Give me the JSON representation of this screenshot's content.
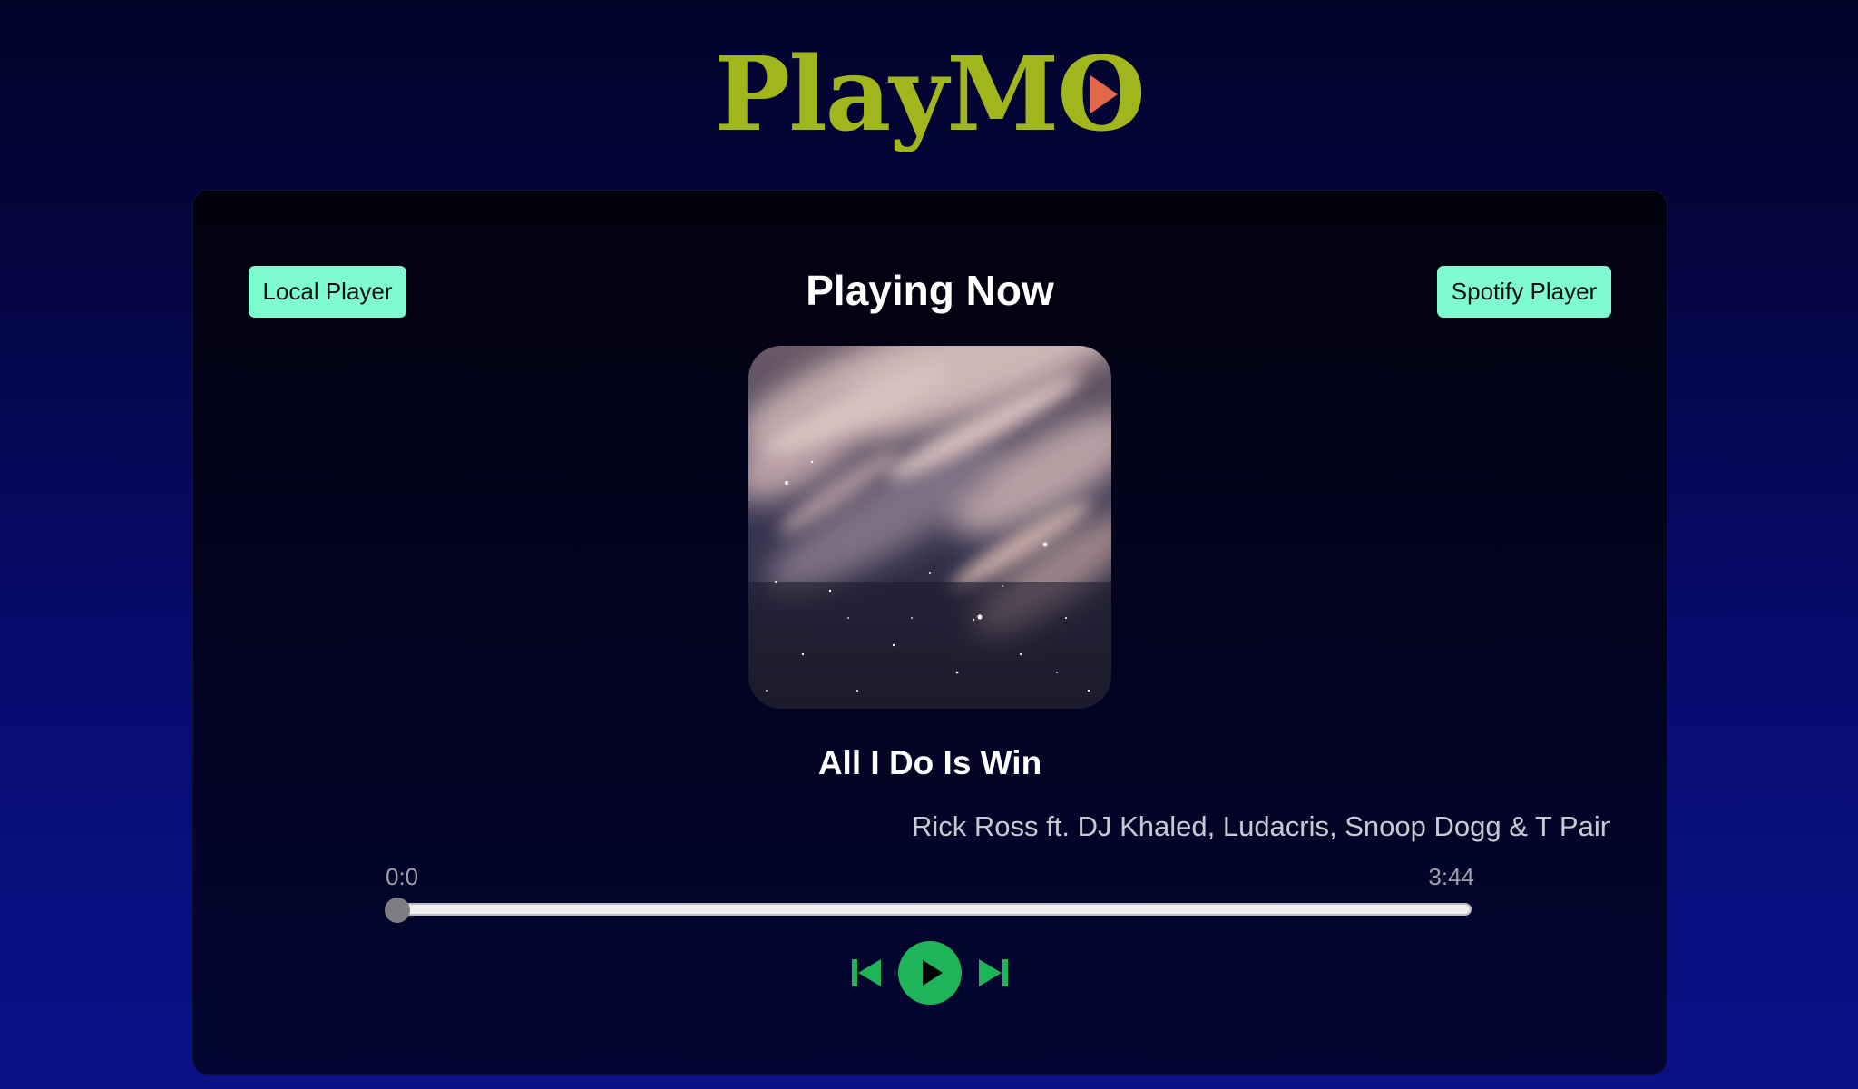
{
  "app": {
    "logo_text_1": "PlayM",
    "logo_text_2": "O",
    "logo_color": "#a1b51d",
    "logo_accent_color": "#e4674a"
  },
  "player": {
    "heading": "Playing Now",
    "local_button_label": "Local Player",
    "spotify_button_label": "Spotify Player",
    "button_color": "#7ffbd0",
    "track": {
      "title": "All I Do Is Win",
      "artist": "Rick Ross ft. DJ Khaled, Ludacris, Snoop Dogg & T Pain",
      "album_art_alt": "album-art-night-sky"
    },
    "progress": {
      "current_time": "0:0",
      "total_time": "3:44",
      "fraction": 0
    },
    "controls": {
      "prev_icon": "skip-back-icon",
      "play_icon": "play-icon",
      "next_icon": "skip-forward-icon",
      "color": "#1db45a"
    }
  }
}
